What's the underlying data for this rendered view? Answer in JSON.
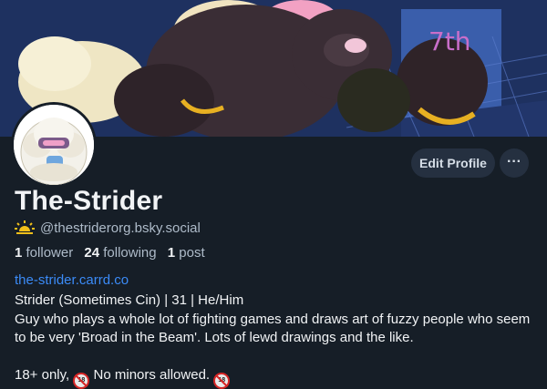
{
  "profile": {
    "display_name": "The-Strider",
    "handle": "@thestriderorg.bsky.social",
    "handle_icon": "sun-icon",
    "stats": {
      "followers_count": "1",
      "followers_label": "follower",
      "following_count": "24",
      "following_label": "following",
      "posts_count": "1",
      "posts_label": "post"
    },
    "link": "the-strider.carrd.co",
    "bio_lines": [
      "Strider (Sometimes Cin) | 31 | He/Him",
      "Guy who plays a whole lot of fighting games and draws art of fuzzy people who seem to be very 'Broad in the Beam'. Lots of lewd drawings and the like."
    ],
    "bio_footer_prefix": "18+ only, ",
    "bio_footer_text": " No minors allowed. ",
    "no_minors_icon": "no-under-18-icon"
  },
  "actions": {
    "edit_profile_label": "Edit Profile",
    "more_label": "···"
  },
  "colors": {
    "background": "#161e27",
    "link": "#3b8bf7",
    "button_bg": "#253040",
    "muted_text": "#aebbc9"
  }
}
